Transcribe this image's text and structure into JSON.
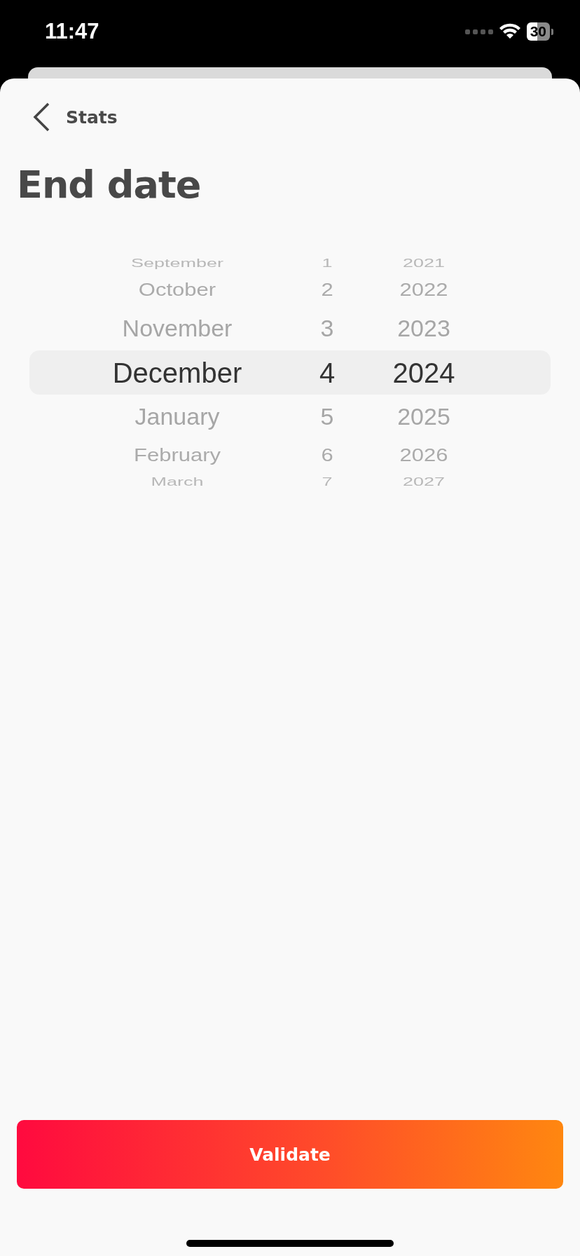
{
  "status_bar": {
    "time": "11:47",
    "battery": "30"
  },
  "nav": {
    "back_label": "Stats"
  },
  "title": "End date",
  "picker": {
    "rows": [
      {
        "month": "September",
        "day": "1",
        "year": "2021",
        "selected": false
      },
      {
        "month": "October",
        "day": "2",
        "year": "2022",
        "selected": false
      },
      {
        "month": "November",
        "day": "3",
        "year": "2023",
        "selected": false
      },
      {
        "month": "December",
        "day": "4",
        "year": "2024",
        "selected": true
      },
      {
        "month": "January",
        "day": "5",
        "year": "2025",
        "selected": false
      },
      {
        "month": "February",
        "day": "6",
        "year": "2026",
        "selected": false
      },
      {
        "month": "March",
        "day": "7",
        "year": "2027",
        "selected": false
      }
    ]
  },
  "buttons": [
    {
      "label": "Validate",
      "kind": "primary"
    }
  ]
}
